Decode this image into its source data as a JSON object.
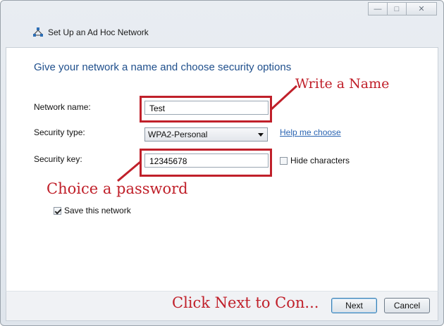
{
  "window": {
    "title": "Set Up an Ad Hoc Network",
    "controls": {
      "minimize": "—",
      "maximize": "□",
      "close": "✕"
    }
  },
  "main": {
    "heading": "Give your network a name and choose security options",
    "network_name": {
      "label": "Network name:",
      "value": "Test"
    },
    "security_type": {
      "label": "Security type:",
      "value": "WPA2-Personal"
    },
    "help_link": "Help me choose",
    "security_key": {
      "label": "Security key:",
      "value": "12345678"
    },
    "hide_characters": {
      "label": "Hide characters",
      "checked": false
    },
    "save_network": {
      "label": "Save this network",
      "checked": true
    }
  },
  "annotations": {
    "write_name": "Write a Name",
    "choose_password": "Choice a password",
    "click_next": "Click Next to Con..."
  },
  "footer": {
    "next_label": "Next",
    "cancel_label": "Cancel"
  },
  "colors": {
    "heading": "#1f4f8c",
    "annotation_red": "#c0202a",
    "link": "#2a64b2"
  }
}
